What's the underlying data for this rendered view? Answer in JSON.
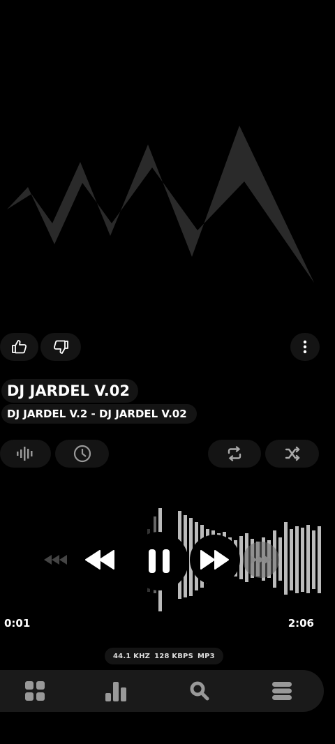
{
  "track": {
    "title": "DJ JARDEL V.02",
    "subtitle": "DJ JARDEL V.2 - DJ JARDEL V.02"
  },
  "playback": {
    "elapsed": "0:01",
    "duration": "2:06",
    "state": "playing"
  },
  "audio_info": {
    "sample_rate": "44.1 KHZ",
    "bitrate": "128 KBPS",
    "format": "MP3"
  },
  "actions": {
    "like_icon": "thumbs-up-icon",
    "dislike_icon": "thumbs-down-icon",
    "more_icon": "more-vertical-icon"
  },
  "toolbar_icons": [
    "equalizer-icon",
    "clock-icon",
    "repeat-icon",
    "shuffle-icon"
  ],
  "controls": [
    "seek-back-icon",
    "rewind-icon",
    "pause-icon",
    "fast-forward-icon",
    "seek-forward-icon"
  ],
  "bottom_nav": [
    "grid-icon",
    "chart-icon",
    "search-icon",
    "menu-icon"
  ],
  "colors": {
    "background": "#000000",
    "pill": "#141414",
    "nav": "#1a1a1a",
    "art": "#2a2a2a"
  }
}
